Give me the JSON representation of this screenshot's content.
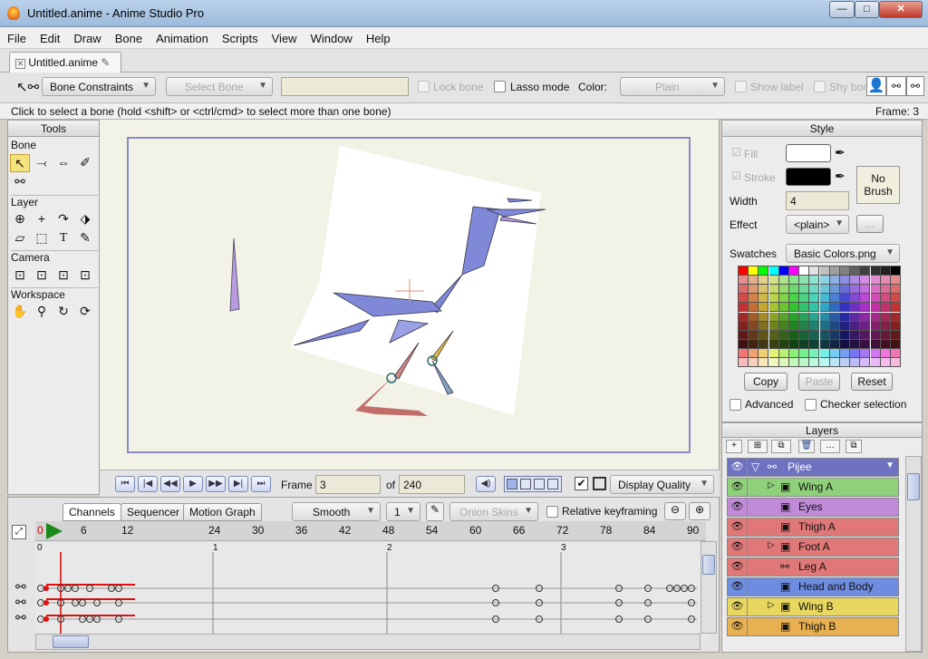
{
  "window": {
    "title": "Untitled.anime - Anime Studio Pro",
    "min": "—",
    "max": "□",
    "close": "✕"
  },
  "menu": [
    "File",
    "Edit",
    "Draw",
    "Bone",
    "Animation",
    "Scripts",
    "View",
    "Window",
    "Help"
  ],
  "doc_tab": {
    "label": "Untitled.anime"
  },
  "toolopts": {
    "bone_constraints": "Bone Constraints",
    "select_bone": "Select Bone",
    "lock_bone": "Lock bone",
    "lasso_mode": "Lasso mode",
    "color_label": "Color:",
    "color_value": "Plain",
    "show_label": "Show label",
    "shy_bones": "Shy bon"
  },
  "status": {
    "message": "Click to select a bone (hold <shift> or <ctrl/cmd> to select more than one bone)",
    "frame": "Frame: 3"
  },
  "tools": {
    "header": "Tools",
    "bone": "Bone",
    "layer": "Layer",
    "camera": "Camera",
    "workspace": "Workspace"
  },
  "playback": {
    "frame_label": "Frame",
    "frame_value": "3",
    "of_label": "of",
    "total": "240",
    "display_quality": "Display Quality"
  },
  "timeline": {
    "tabs": [
      "Channels",
      "Sequencer",
      "Motion Graph"
    ],
    "smooth": "Smooth",
    "interp": "1",
    "onion": "Onion Skins",
    "relative": "Relative keyframing",
    "ruler": [
      "0",
      "6",
      "12",
      "24",
      "30",
      "36",
      "42",
      "48",
      "54",
      "60",
      "66",
      "72",
      "78",
      "84",
      "90"
    ],
    "seconds": [
      "0",
      "1",
      "2",
      "3"
    ]
  },
  "style": {
    "header": "Style",
    "fill": "Fill",
    "stroke": "Stroke",
    "width_label": "Width",
    "width_value": "4",
    "effect_label": "Effect",
    "effect_value": "<plain>",
    "effect_btn": "...",
    "no_brush": "No Brush",
    "swatches_label": "Swatches",
    "swatches_value": "Basic Colors.png",
    "copy": "Copy",
    "paste": "Paste",
    "reset": "Reset",
    "advanced": "Advanced",
    "checker": "Checker selection"
  },
  "layers": {
    "header": "Layers",
    "items": [
      {
        "name": "Pijee",
        "color": "#6e72c0"
      },
      {
        "name": "Wing A",
        "color": "#8fd17a"
      },
      {
        "name": "Eyes",
        "color": "#c08ad8"
      },
      {
        "name": "Thigh A",
        "color": "#e07878"
      },
      {
        "name": "Foot A",
        "color": "#e07878"
      },
      {
        "name": "Leg  A",
        "color": "#e07878"
      },
      {
        "name": "Head and Body",
        "color": "#6e8ce0"
      },
      {
        "name": "Wing B",
        "color": "#e8d860"
      },
      {
        "name": "Thigh B",
        "color": "#e8b050"
      }
    ]
  }
}
